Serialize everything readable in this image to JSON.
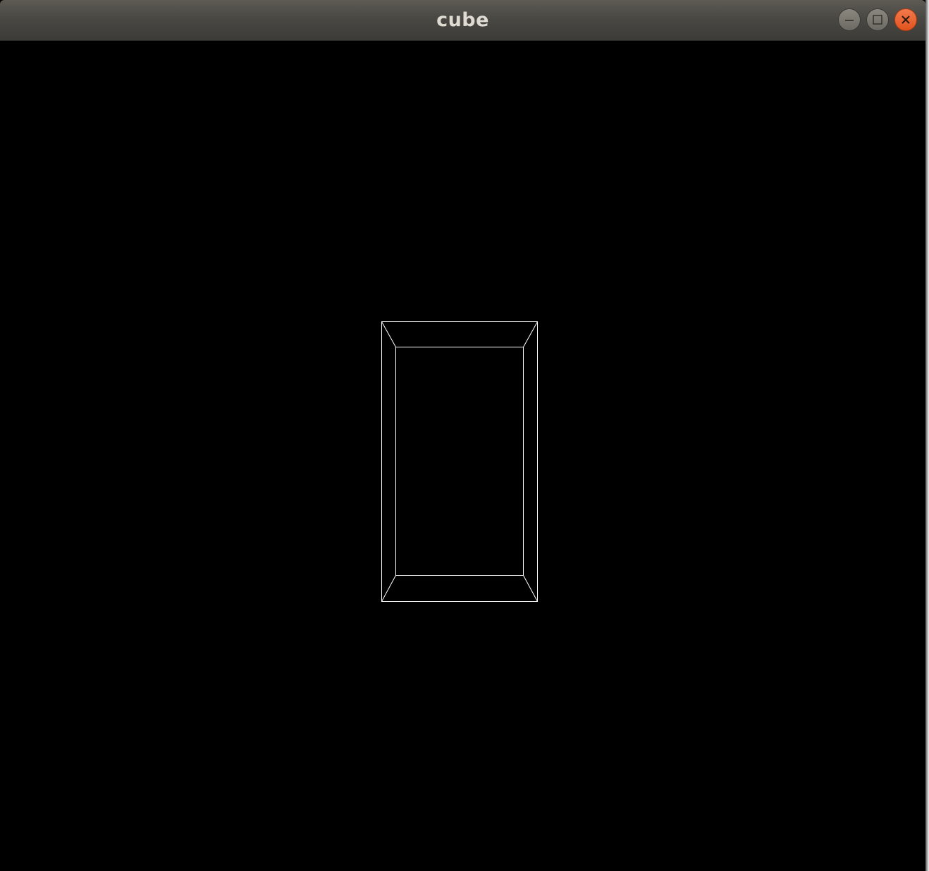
{
  "window": {
    "title": "cube",
    "controls": {
      "minimize": "minimize",
      "maximize": "maximize",
      "close": "close"
    }
  },
  "scene": {
    "background": "#000000",
    "line_color": "#ffffff",
    "object": "wireframe cube"
  },
  "colors": {
    "titlebar": "#4a4843",
    "title_text": "#dfdbd2",
    "close_button": "#e95420"
  }
}
